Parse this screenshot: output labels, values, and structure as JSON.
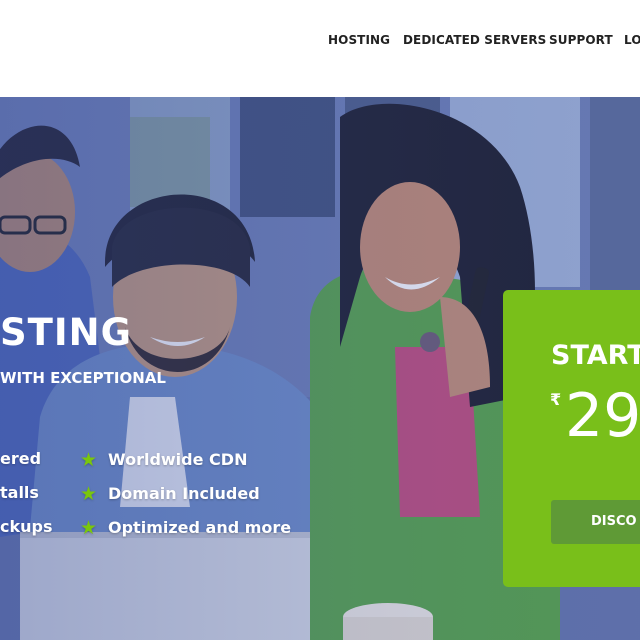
{
  "header": {
    "nav": [
      {
        "label": "HOSTING"
      },
      {
        "label": "DEDICATED SERVERS"
      },
      {
        "label": "SUPPORT"
      },
      {
        "label": "LO"
      }
    ]
  },
  "hero": {
    "title": "STING",
    "subtitle": "WITH EXCEPTIONAL",
    "features_left": [
      {
        "label": "ered"
      },
      {
        "label": "talls"
      },
      {
        "label": "ckups"
      }
    ],
    "features_right": [
      {
        "label": "Worldwide CDN"
      },
      {
        "label": "Domain Included"
      },
      {
        "label": "Optimized and more"
      }
    ],
    "feature_icon": "star-icon"
  },
  "pricing": {
    "starting_label": "START",
    "currency_symbol": "₹",
    "amount": "29",
    "button_label": "DISCO"
  },
  "colors": {
    "accent_green": "#79bf1a",
    "button_green": "#5f9a36",
    "star_green": "#7ac70c",
    "nav_text": "#222222"
  }
}
